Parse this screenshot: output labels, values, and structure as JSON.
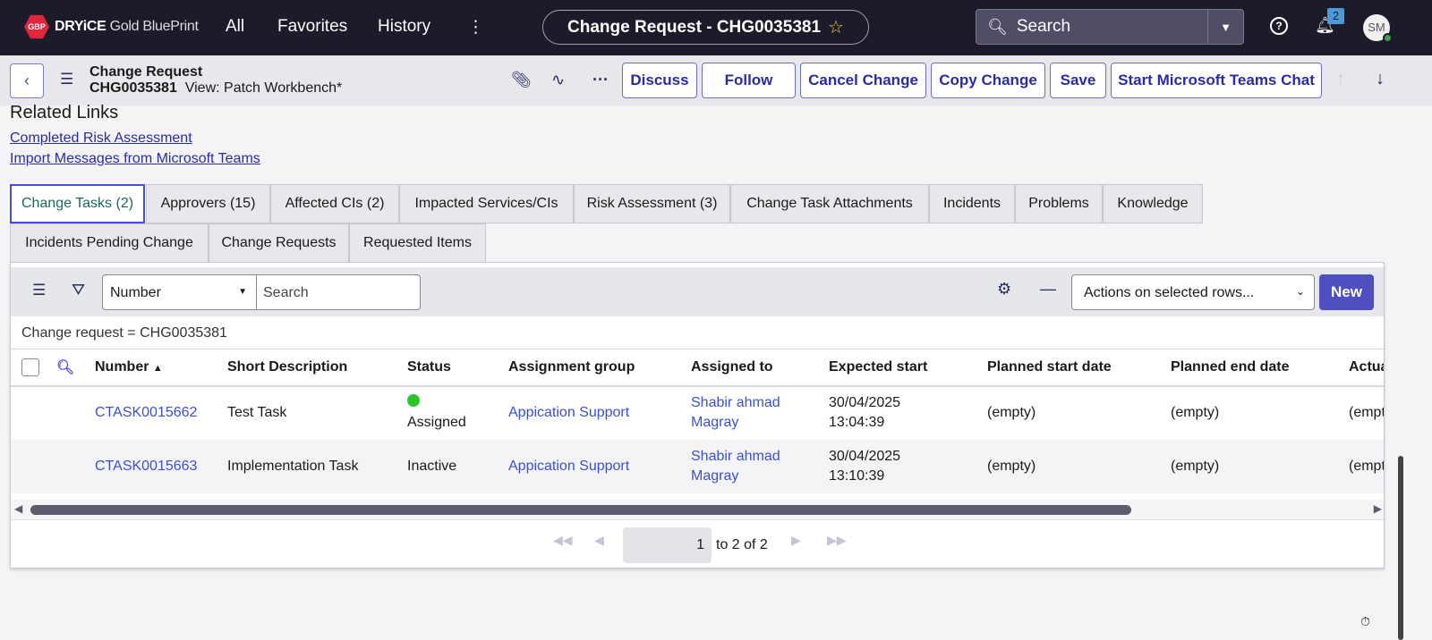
{
  "topnav": {
    "logo_badge": "GBP",
    "logo_brand": "DRYiCE",
    "logo_sub": "Gold BluePrint",
    "links": [
      "All",
      "Favorites",
      "History"
    ],
    "record_title": "Change Request - CHG0035381",
    "search_placeholder": "Search",
    "notification_count": "2",
    "avatar_initials": "SM"
  },
  "record": {
    "type": "Change Request",
    "number": "CHG0035381",
    "view": "View: Patch Workbench*"
  },
  "buttons": {
    "discuss": "Discuss",
    "follow": "Follow",
    "cancel": "Cancel Change",
    "copy": "Copy Change",
    "save": "Save",
    "teams": "Start Microsoft Teams Chat"
  },
  "related": {
    "heading": "Related Links",
    "links": [
      "Completed Risk Assessment",
      "Import Messages from Microsoft Teams"
    ]
  },
  "tabs": [
    "Change Tasks (2)",
    "Approvers (15)",
    "Affected CIs (2)",
    "Impacted Services/CIs",
    "Risk Assessment (3)",
    "Change Task Attachments",
    "Incidents",
    "Problems",
    "Knowledge",
    "Incidents Pending Change",
    "Change Requests",
    "Requested Items"
  ],
  "list": {
    "field_select": "Number",
    "search_placeholder": "Search",
    "actions": "Actions on selected rows...",
    "new_label": "New",
    "breadcrumb": "Change request = CHG0035381",
    "columns": [
      "Number",
      "Short Description",
      "Status",
      "Assignment group",
      "Assigned to",
      "Expected start",
      "Planned start date",
      "Planned end date",
      "Actual"
    ],
    "rows": [
      {
        "number": "CTASK0015662",
        "short": "Test Task",
        "status": "Assigned",
        "group": "Appication Support",
        "assigned": [
          "Shabir ahmad",
          "Magray"
        ],
        "expected": [
          "30/04/2025",
          "13:04:39"
        ],
        "pstart": "(empty)",
        "pend": "(empty)",
        "actual": "(empty)"
      },
      {
        "number": "CTASK0015663",
        "short": "Implementation Task",
        "status": "Inactive",
        "group": "Appication Support",
        "assigned": [
          "Shabir ahmad",
          "Magray"
        ],
        "expected": [
          "30/04/2025",
          "13:10:39"
        ],
        "pstart": "(empty)",
        "pend": "(empty)",
        "actual": "(empty)"
      }
    ],
    "pager": {
      "page": "1",
      "range": "to 2 of 2"
    }
  }
}
